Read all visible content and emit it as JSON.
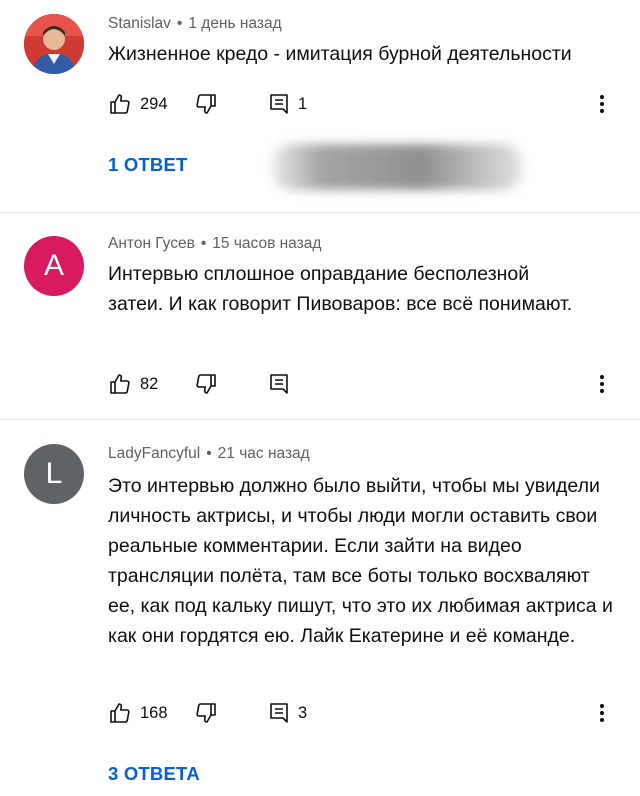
{
  "comments": [
    {
      "author": "Stanislav",
      "time": "1 день назад",
      "text": "Жизненное кредо - имитация бурной деятельности",
      "likes": "294",
      "replies_count": "1",
      "replies_link": "1 ОТВЕТ",
      "avatar_kind": "photo"
    },
    {
      "author": "Антон Гусев",
      "time": "15 часов назад",
      "text": "Интервью сплошное оправдание бесполезной затеи. И как говорит Пивоваров: все всё понимают.",
      "likes": "82",
      "avatar_letter": "A",
      "avatar_color": "#d81b60"
    },
    {
      "author": "LadyFancyful",
      "time": "21 час назад",
      "text": "Это интервью должно было выйти, чтобы мы увидели личность актрисы, и чтобы люди могли оставить свои реальные комментарии. Если зайти на видео трансляции полёта, там все боты только восхваляют ее, как под кальку пишут, что это их любимая актриса и как они гордятся ею. Лайк Екатерине и её команде.",
      "likes": "168",
      "replies_count": "3",
      "replies_link": "3 ОТВЕТА",
      "avatar_letter": "L",
      "avatar_color": "#5f6368"
    }
  ],
  "separator": "•",
  "icons": [
    "thumb-up-icon",
    "thumb-down-icon",
    "reply-icon",
    "more-vert-icon"
  ],
  "colors": {
    "link_blue": "#065fd4",
    "meta_gray": "#606060"
  }
}
